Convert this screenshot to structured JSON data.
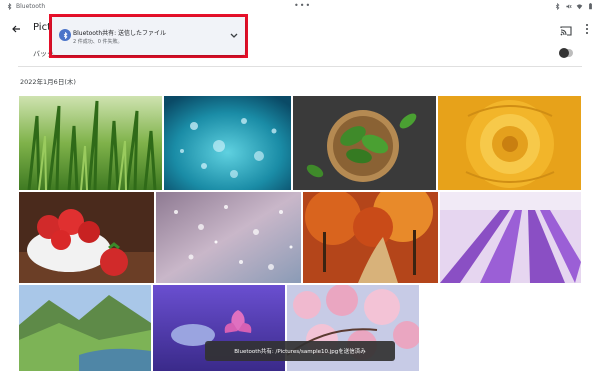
{
  "statusbar": {
    "app_label": "Bluetooth",
    "dots": "•••",
    "icons": [
      "bluetooth-icon",
      "mute-icon",
      "wifi-icon",
      "battery-icon"
    ]
  },
  "appbar": {
    "title": "Pictur",
    "icons": [
      "back-arrow-icon",
      "cast-icon",
      "more-vert-icon"
    ]
  },
  "backup": {
    "label": "バックアップ",
    "toggle_on": false
  },
  "gallery": {
    "date_heading": "2022年1月6日(木)",
    "photos": [
      {
        "name": "photo-grass",
        "subject": "grass with dew"
      },
      {
        "name": "photo-water-bubbles",
        "subject": "underwater bubbles"
      },
      {
        "name": "photo-basil-bowl",
        "subject": "basil leaves in bowl"
      },
      {
        "name": "photo-yellow-rose",
        "subject": "yellow rose"
      },
      {
        "name": "photo-strawberries",
        "subject": "strawberries in bowl"
      },
      {
        "name": "photo-bokeh-snow",
        "subject": "sparkling bokeh"
      },
      {
        "name": "photo-autumn-road",
        "subject": "autumn forest road"
      },
      {
        "name": "photo-lavender-field",
        "subject": "lavender field"
      },
      {
        "name": "photo-mountain-valley",
        "subject": "green mountain valley"
      },
      {
        "name": "photo-lotus-pond",
        "subject": "lotus on purple water"
      },
      {
        "name": "photo-cherry-blossoms",
        "subject": "cherry blossoms"
      }
    ]
  },
  "notification": {
    "title": "Bluetooth共有: 送信したファイル",
    "subtitle": "2 件成功、0 件失敗。",
    "highlight_color": "#e8102a"
  },
  "toast": {
    "message": "Bluetooth共有:                              /Pictures/sample10.jpgを送信済み"
  }
}
